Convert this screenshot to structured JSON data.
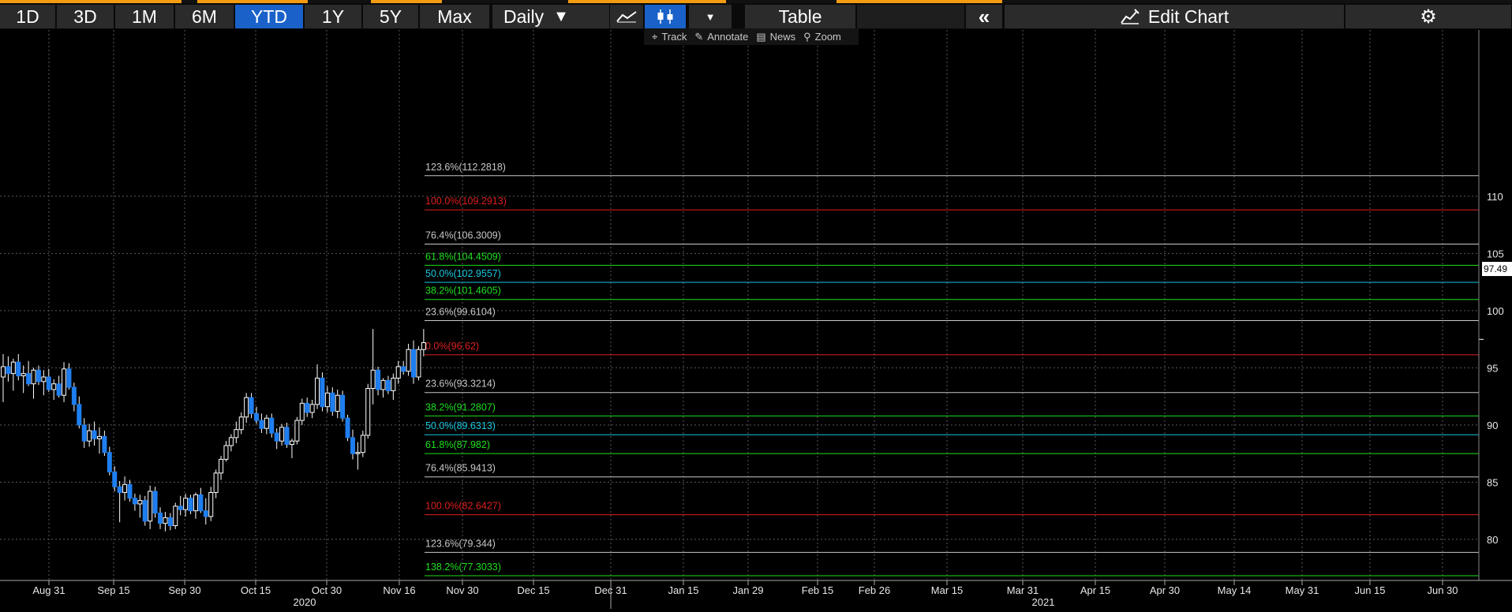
{
  "toolbar": {
    "periods": [
      {
        "label": "1D",
        "active": false
      },
      {
        "label": "3D",
        "active": false
      },
      {
        "label": "1M",
        "active": false
      },
      {
        "label": "6M",
        "active": false
      },
      {
        "label": "YTD",
        "active": true
      },
      {
        "label": "1Y",
        "active": false
      },
      {
        "label": "5Y",
        "active": false
      },
      {
        "label": "Max",
        "active": false
      }
    ],
    "frequency": "Daily",
    "table_label": "Table",
    "edit_chart_label": "Edit Chart",
    "icons": [
      "line-chart-icon",
      "candlestick-icon",
      "dropdown-arrow-icon",
      "collapse-left-icon",
      "edit-chart-icon",
      "gear-icon"
    ]
  },
  "subtoolbar": {
    "track": "Track",
    "annotate": "Annotate",
    "news": "News",
    "zoom": "Zoom"
  },
  "last_price": "97.49",
  "colors": {
    "background": "#000000",
    "accent_blue": "#1a62c9",
    "up_candle": "#ffffff",
    "down_candle": "#1e7ef0",
    "fib_red": "#e01e1e",
    "fib_green": "#1ee01e",
    "fib_cyan": "#18c8e0",
    "fib_gray": "#c8c8c8"
  },
  "chart_data": {
    "type": "candlestick",
    "y_range": [
      77.3033,
      112.2818
    ],
    "y_ticks": [
      "80",
      "85",
      "90",
      "95",
      "100",
      "105",
      "110"
    ],
    "x_ticks": [
      "Aug 31",
      "Sep 15",
      "Sep 30",
      "Oct 15",
      "Oct 30",
      "Nov 16",
      "Nov 30",
      "Dec 15",
      "Dec 31",
      "Jan 15",
      "Jan 29",
      "Feb 15",
      "Feb 26",
      "Mar 15",
      "Mar 31",
      "Apr 15",
      "Apr 30",
      "May 14",
      "May 31",
      "Jun 15",
      "Jun 30"
    ],
    "year_labels": [
      "2020",
      "2021"
    ],
    "fib_levels": [
      {
        "label": "123.6%(112.2818)",
        "value": 112.2818,
        "color": "gray"
      },
      {
        "label": "100.0%(109.2913)",
        "value": 109.2913,
        "color": "red"
      },
      {
        "label": "76.4%(106.3009)",
        "value": 106.3009,
        "color": "gray"
      },
      {
        "label": "61.8%(104.4509)",
        "value": 104.4509,
        "color": "green"
      },
      {
        "label": "50.0%(102.9557)",
        "value": 102.9557,
        "color": "cyan"
      },
      {
        "label": "38.2%(101.4605)",
        "value": 101.4605,
        "color": "green"
      },
      {
        "label": "23.6%(99.6104)",
        "value": 99.6104,
        "color": "gray"
      },
      {
        "label": "0.0%(96.62)",
        "value": 96.62,
        "color": "red"
      },
      {
        "label": "23.6%(93.3214)",
        "value": 93.3214,
        "color": "gray"
      },
      {
        "label": "38.2%(91.2807)",
        "value": 91.2807,
        "color": "green"
      },
      {
        "label": "50.0%(89.6313)",
        "value": 89.6313,
        "color": "cyan"
      },
      {
        "label": "61.8%(87.982)",
        "value": 87.982,
        "color": "green"
      },
      {
        "label": "76.4%(85.9413)",
        "value": 85.9413,
        "color": "gray"
      },
      {
        "label": "100.0%(82.6427)",
        "value": 82.6427,
        "color": "red"
      },
      {
        "label": "123.6%(79.344)",
        "value": 79.344,
        "color": "gray"
      },
      {
        "label": "138.2%(77.3033)",
        "value": 77.3033,
        "color": "green"
      }
    ],
    "candles": [
      {
        "o": 94.2,
        "h": 96.2,
        "l": 92.0,
        "c": 95.1
      },
      {
        "o": 95.1,
        "h": 96.0,
        "l": 93.8,
        "c": 94.5
      },
      {
        "o": 94.5,
        "h": 95.8,
        "l": 93.0,
        "c": 95.5
      },
      {
        "o": 95.5,
        "h": 96.2,
        "l": 93.9,
        "c": 94.3
      },
      {
        "o": 94.3,
        "h": 95.2,
        "l": 92.8,
        "c": 94.5
      },
      {
        "o": 94.5,
        "h": 95.6,
        "l": 93.4,
        "c": 93.6
      },
      {
        "o": 93.6,
        "h": 95.0,
        "l": 92.3,
        "c": 94.8
      },
      {
        "o": 94.8,
        "h": 95.2,
        "l": 93.5,
        "c": 93.8
      },
      {
        "o": 93.8,
        "h": 94.8,
        "l": 92.6,
        "c": 94.2
      },
      {
        "o": 94.2,
        "h": 94.9,
        "l": 92.9,
        "c": 93.1
      },
      {
        "o": 93.1,
        "h": 94.0,
        "l": 92.2,
        "c": 93.6
      },
      {
        "o": 93.6,
        "h": 94.3,
        "l": 92.4,
        "c": 92.6
      },
      {
        "o": 92.6,
        "h": 95.5,
        "l": 92.0,
        "c": 94.9
      },
      {
        "o": 94.9,
        "h": 95.4,
        "l": 93.1,
        "c": 93.3
      },
      {
        "o": 93.3,
        "h": 93.7,
        "l": 91.2,
        "c": 91.8
      },
      {
        "o": 91.8,
        "h": 92.5,
        "l": 89.7,
        "c": 90.0
      },
      {
        "o": 90.0,
        "h": 90.6,
        "l": 88.0,
        "c": 88.6
      },
      {
        "o": 88.6,
        "h": 90.1,
        "l": 88.1,
        "c": 89.5
      },
      {
        "o": 89.5,
        "h": 90.3,
        "l": 88.2,
        "c": 88.8
      },
      {
        "o": 88.8,
        "h": 89.8,
        "l": 87.5,
        "c": 89.0
      },
      {
        "o": 89.0,
        "h": 89.5,
        "l": 87.3,
        "c": 87.6
      },
      {
        "o": 87.6,
        "h": 88.1,
        "l": 85.6,
        "c": 85.9
      },
      {
        "o": 85.9,
        "h": 86.4,
        "l": 84.2,
        "c": 84.6
      },
      {
        "o": 84.6,
        "h": 85.1,
        "l": 81.5,
        "c": 84.1
      },
      {
        "o": 84.1,
        "h": 85.5,
        "l": 83.4,
        "c": 84.8
      },
      {
        "o": 84.8,
        "h": 85.2,
        "l": 83.3,
        "c": 83.6
      },
      {
        "o": 83.6,
        "h": 84.0,
        "l": 82.5,
        "c": 83.1
      },
      {
        "o": 83.1,
        "h": 83.9,
        "l": 81.9,
        "c": 83.4
      },
      {
        "o": 83.4,
        "h": 83.8,
        "l": 81.2,
        "c": 81.6
      },
      {
        "o": 81.6,
        "h": 84.7,
        "l": 80.9,
        "c": 84.2
      },
      {
        "o": 84.2,
        "h": 84.6,
        "l": 81.9,
        "c": 82.3
      },
      {
        "o": 82.3,
        "h": 82.8,
        "l": 80.9,
        "c": 81.4
      },
      {
        "o": 81.4,
        "h": 82.4,
        "l": 80.7,
        "c": 81.9
      },
      {
        "o": 81.9,
        "h": 82.3,
        "l": 80.8,
        "c": 81.2
      },
      {
        "o": 81.2,
        "h": 83.2,
        "l": 80.9,
        "c": 82.9
      },
      {
        "o": 82.9,
        "h": 83.8,
        "l": 82.1,
        "c": 82.6
      },
      {
        "o": 82.6,
        "h": 84.0,
        "l": 82.0,
        "c": 83.6
      },
      {
        "o": 83.6,
        "h": 83.9,
        "l": 82.2,
        "c": 82.5
      },
      {
        "o": 82.5,
        "h": 84.1,
        "l": 81.8,
        "c": 83.9
      },
      {
        "o": 83.9,
        "h": 84.5,
        "l": 82.3,
        "c": 82.5
      },
      {
        "o": 82.5,
        "h": 83.6,
        "l": 81.3,
        "c": 82.0
      },
      {
        "o": 82.0,
        "h": 84.6,
        "l": 81.6,
        "c": 84.1
      },
      {
        "o": 84.1,
        "h": 86.1,
        "l": 83.6,
        "c": 85.8
      },
      {
        "o": 85.8,
        "h": 87.3,
        "l": 85.2,
        "c": 87.0
      },
      {
        "o": 87.0,
        "h": 88.6,
        "l": 86.8,
        "c": 88.2
      },
      {
        "o": 88.2,
        "h": 89.2,
        "l": 87.7,
        "c": 88.9
      },
      {
        "o": 88.9,
        "h": 90.3,
        "l": 88.4,
        "c": 89.6
      },
      {
        "o": 89.6,
        "h": 91.1,
        "l": 89.2,
        "c": 90.7
      },
      {
        "o": 90.7,
        "h": 92.8,
        "l": 90.2,
        "c": 92.4
      },
      {
        "o": 92.4,
        "h": 92.8,
        "l": 90.6,
        "c": 91.0
      },
      {
        "o": 91.0,
        "h": 91.6,
        "l": 90.1,
        "c": 90.4
      },
      {
        "o": 90.4,
        "h": 91.0,
        "l": 89.3,
        "c": 89.7
      },
      {
        "o": 89.7,
        "h": 90.9,
        "l": 89.2,
        "c": 90.6
      },
      {
        "o": 90.6,
        "h": 91.0,
        "l": 88.9,
        "c": 89.3
      },
      {
        "o": 89.3,
        "h": 89.7,
        "l": 87.9,
        "c": 88.6
      },
      {
        "o": 88.6,
        "h": 90.1,
        "l": 88.2,
        "c": 89.8
      },
      {
        "o": 89.8,
        "h": 90.2,
        "l": 88.0,
        "c": 88.3
      },
      {
        "o": 88.3,
        "h": 88.8,
        "l": 87.1,
        "c": 88.6
      },
      {
        "o": 88.6,
        "h": 90.7,
        "l": 88.3,
        "c": 90.4
      },
      {
        "o": 90.4,
        "h": 92.3,
        "l": 90.0,
        "c": 91.9
      },
      {
        "o": 91.9,
        "h": 92.4,
        "l": 90.7,
        "c": 91.1
      },
      {
        "o": 91.1,
        "h": 92.2,
        "l": 90.6,
        "c": 91.8
      },
      {
        "o": 91.8,
        "h": 95.3,
        "l": 91.4,
        "c": 94.1
      },
      {
        "o": 94.1,
        "h": 94.6,
        "l": 91.2,
        "c": 91.6
      },
      {
        "o": 91.6,
        "h": 93.4,
        "l": 91.1,
        "c": 92.8
      },
      {
        "o": 92.8,
        "h": 93.3,
        "l": 90.8,
        "c": 91.2
      },
      {
        "o": 91.2,
        "h": 93.1,
        "l": 90.6,
        "c": 92.6
      },
      {
        "o": 92.6,
        "h": 93.0,
        "l": 90.3,
        "c": 90.6
      },
      {
        "o": 90.6,
        "h": 90.9,
        "l": 88.6,
        "c": 88.9
      },
      {
        "o": 88.9,
        "h": 89.6,
        "l": 87.0,
        "c": 87.5
      },
      {
        "o": 87.5,
        "h": 88.5,
        "l": 86.1,
        "c": 87.6
      },
      {
        "o": 87.6,
        "h": 89.5,
        "l": 87.2,
        "c": 89.1
      },
      {
        "o": 89.1,
        "h": 93.6,
        "l": 88.8,
        "c": 93.2
      },
      {
        "o": 93.2,
        "h": 98.4,
        "l": 91.8,
        "c": 94.8
      },
      {
        "o": 94.8,
        "h": 95.1,
        "l": 92.6,
        "c": 93.1
      },
      {
        "o": 93.1,
        "h": 94.1,
        "l": 92.4,
        "c": 93.9
      },
      {
        "o": 93.9,
        "h": 94.3,
        "l": 92.7,
        "c": 93.0
      },
      {
        "o": 93.0,
        "h": 94.5,
        "l": 92.2,
        "c": 94.1
      },
      {
        "o": 94.1,
        "h": 95.6,
        "l": 93.6,
        "c": 95.1
      },
      {
        "o": 95.1,
        "h": 95.6,
        "l": 94.4,
        "c": 94.7
      },
      {
        "o": 94.7,
        "h": 97.1,
        "l": 94.3,
        "c": 96.6
      },
      {
        "o": 96.6,
        "h": 97.4,
        "l": 93.6,
        "c": 94.2
      },
      {
        "o": 94.2,
        "h": 96.9,
        "l": 93.9,
        "c": 96.6
      },
      {
        "o": 96.6,
        "h": 98.4,
        "l": 96.0,
        "c": 97.2
      }
    ]
  }
}
